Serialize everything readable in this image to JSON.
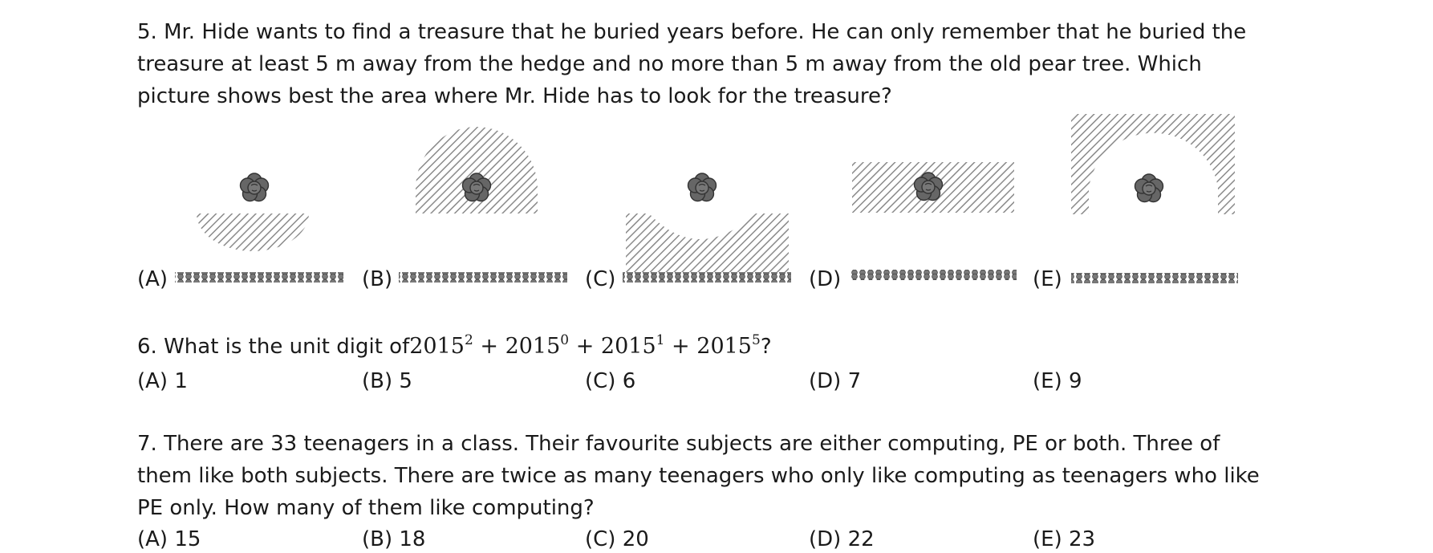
{
  "colors": {
    "text": "#1a1a1a",
    "hatch": "#8a8a8a",
    "tree": "#555555",
    "hedge": "#6a6a6a"
  },
  "q5": {
    "lines": [
      "5. Mr. Hide wants to find a treasure that he buried years before. He can only remember that he buried the",
      "treasure at least 5 m away from the hedge and no more than 5 m away from the old pear tree. Which",
      "picture shows best the area where Mr. Hide has to look for the treasure?"
    ],
    "options": [
      "(A)",
      "(B)",
      "(C)",
      "(D)",
      "(E)"
    ]
  },
  "q6": {
    "prefix": "6. What is the unit digit of",
    "base": "2015",
    "exponents": [
      "2",
      "0",
      "1",
      "5"
    ],
    "plus": " + ",
    "suffix": "?",
    "options": [
      "(A) 1",
      "(B) 5",
      "(C) 6",
      "(D) 7",
      "(E) 9"
    ]
  },
  "q7": {
    "lines": [
      "7. There are 33 teenagers in a class. Their favourite subjects are either computing, PE or both. Three of",
      "them like both subjects. There are twice as many teenagers who only like computing as teenagers who like",
      "PE only. How many of them like computing?"
    ],
    "options": [
      "(A) 15",
      "(B) 18",
      "(C) 20",
      "(D) 22",
      "(E) 23"
    ]
  }
}
